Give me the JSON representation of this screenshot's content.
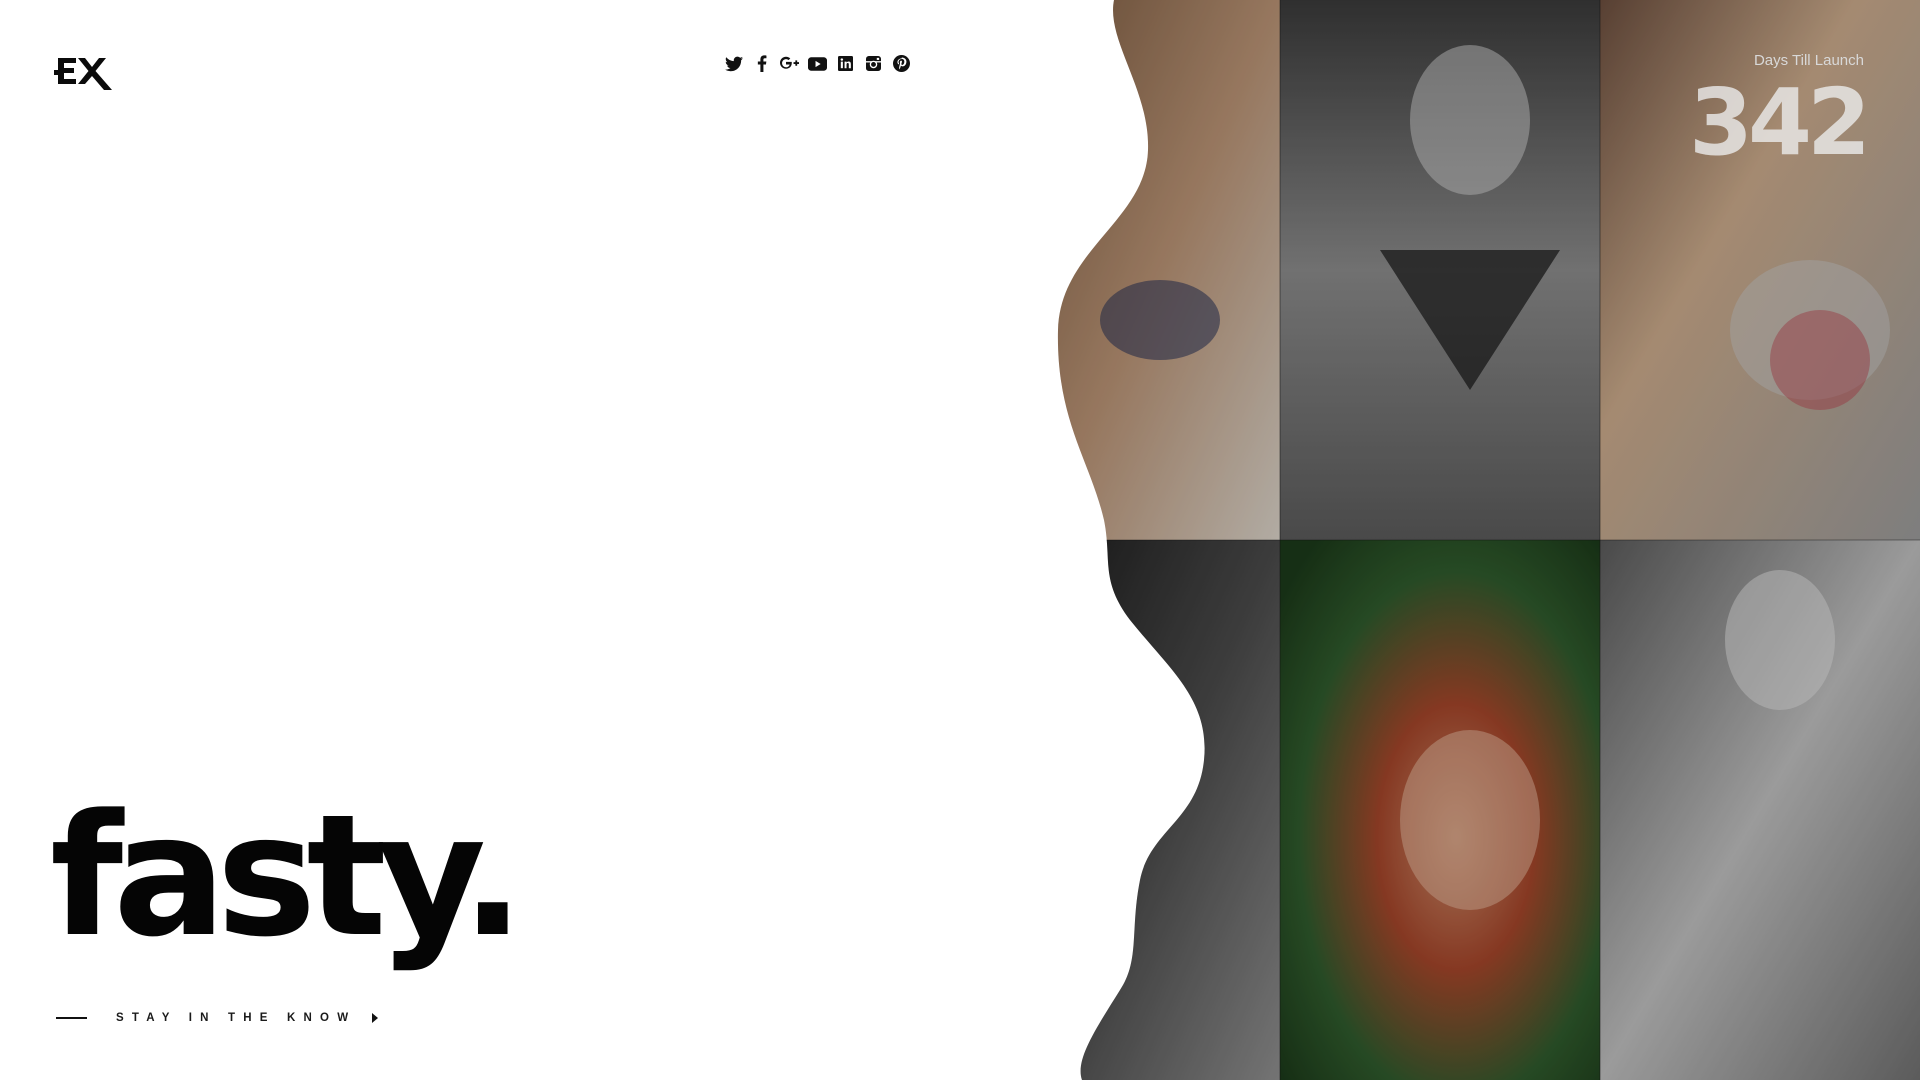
{
  "brand": {
    "logo_text": "EX"
  },
  "social": [
    {
      "icon": "twitter-icon"
    },
    {
      "icon": "facebook-icon"
    },
    {
      "icon": "google-plus-icon"
    },
    {
      "icon": "youtube-icon"
    },
    {
      "icon": "linkedin-icon"
    },
    {
      "icon": "instagram-icon"
    },
    {
      "icon": "pinterest-icon"
    }
  ],
  "hero": {
    "title": "fasty.",
    "cta_label": "STAY IN THE KNOW"
  },
  "countdown": {
    "caption": "Days Till Launch",
    "value": "342"
  },
  "gallery": {
    "photos": [
      "woman-in-hammock-photo",
      "tattooed-couple-photo",
      "blonde-woman-born-to-ride-tee-photo",
      "person-in-black-leggings-photo",
      "red-haired-woman-with-flowers-photo",
      "woman-in-sunglasses-denim-jacket-photo"
    ]
  },
  "colors": {
    "background": "#ffffff",
    "text": "#050505",
    "overlay": "#000000"
  }
}
